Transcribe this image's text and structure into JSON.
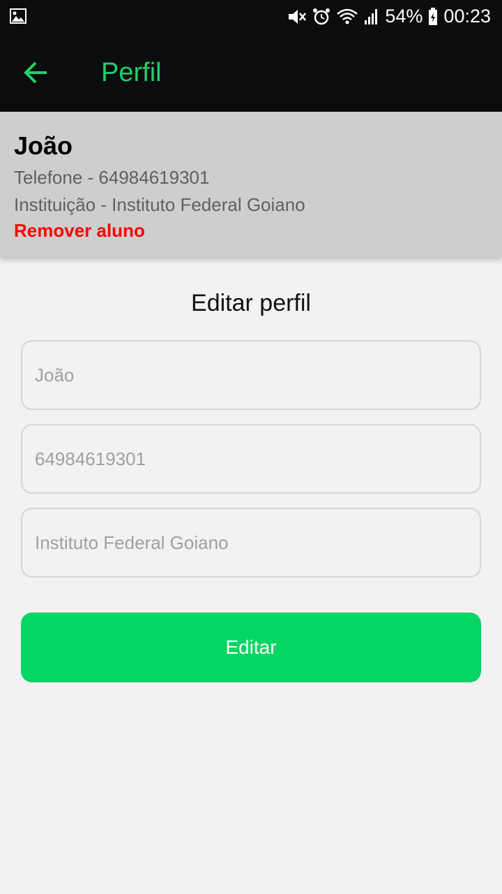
{
  "status_bar": {
    "battery": "54%",
    "time": "00:23",
    "icons": [
      "image-notification-icon",
      "mute-icon",
      "alarm-icon",
      "wifi-icon",
      "signal-icon",
      "battery-icon"
    ]
  },
  "app_bar": {
    "title": "Perfil",
    "back_icon": "arrow-left-icon",
    "accent_color": "#22d069"
  },
  "profile": {
    "name": "João",
    "phone_line": "Telefone - 64984619301",
    "institution_line": "Instituição - Instituto Federal Goiano",
    "remove_label": "Remover aluno",
    "remove_color": "#ff0000"
  },
  "edit_form": {
    "title": "Editar perfil",
    "name_placeholder": "João",
    "phone_placeholder": "64984619301",
    "institution_placeholder": "Instituto Federal Goiano",
    "submit_label": "Editar",
    "submit_color": "#04d663"
  }
}
